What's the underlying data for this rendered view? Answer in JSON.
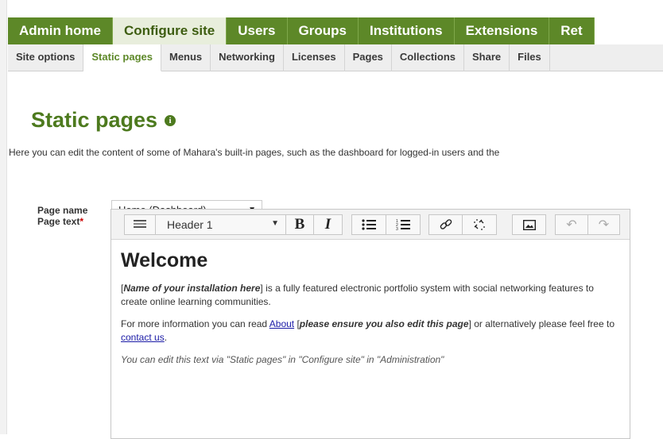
{
  "main_nav": {
    "tabs": [
      {
        "label": "Admin home",
        "active": false
      },
      {
        "label": "Configure site",
        "active": true
      },
      {
        "label": "Users",
        "active": false
      },
      {
        "label": "Groups",
        "active": false
      },
      {
        "label": "Institutions",
        "active": false
      },
      {
        "label": "Extensions",
        "active": false
      },
      {
        "label": "Ret",
        "active": false
      }
    ]
  },
  "sub_nav": {
    "tabs": [
      {
        "label": "Site options",
        "active": false
      },
      {
        "label": "Static pages",
        "active": true
      },
      {
        "label": "Menus",
        "active": false
      },
      {
        "label": "Networking",
        "active": false
      },
      {
        "label": "Licenses",
        "active": false
      },
      {
        "label": "Pages",
        "active": false
      },
      {
        "label": "Collections",
        "active": false
      },
      {
        "label": "Share",
        "active": false
      },
      {
        "label": "Files",
        "active": false
      }
    ]
  },
  "page": {
    "title": "Static pages",
    "info_icon": "info-icon",
    "intro": "Here you can edit the content of some of Mahara's built-in pages, such as the dashboard for logged-in users and the"
  },
  "form": {
    "page_name_label": "Page name",
    "page_name_value": "Home (Dashboard)",
    "page_text_label": "Page text",
    "required_marker": "*"
  },
  "toolbar": {
    "format_value": "Header 1",
    "icons": [
      "toolbar-toggle-icon",
      "bold-icon",
      "italic-icon",
      "bullet-list-icon",
      "numbered-list-icon",
      "link-icon",
      "unlink-icon",
      "image-icon",
      "undo-icon",
      "redo-icon"
    ]
  },
  "editor": {
    "heading": "Welcome",
    "p1_bracket_open": "[",
    "p1_placeholder": "Name of your installation here",
    "p1_bracket_close": "]",
    "p1_rest": " is a fully featured electronic portfolio system with social networking features to create online learning communities.",
    "p2_start": "For more information you can read ",
    "p2_link_about": "About",
    "p2_bracket_open": " [",
    "p2_note": "please ensure you also edit this page",
    "p2_bracket_close": "]",
    "p2_middle": " or alternatively please feel free to ",
    "p2_link_contact": "contact us",
    "p2_end": ".",
    "p3": "You can edit this text via \"Static pages\" in \"Configure site\" in \"Administration\""
  },
  "colors": {
    "nav_green": "#5d8828",
    "title_green": "#4d7a1e",
    "link_blue": "#1a1aa6"
  }
}
